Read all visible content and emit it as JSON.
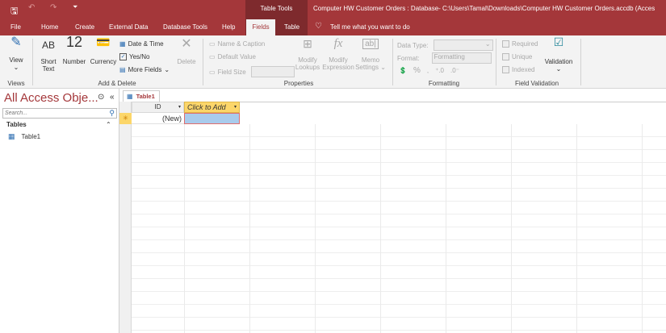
{
  "titlebar": {
    "context_group": "Table Tools",
    "title": "Computer HW Customer Orders : Database- C:\\Users\\Tamal\\Downloads\\Computer HW Customer Orders.accdb (Acces"
  },
  "tabs": [
    "File",
    "Home",
    "Create",
    "External Data",
    "Database Tools",
    "Help",
    "Fields",
    "Table"
  ],
  "tell_me": "Tell me what you want to do",
  "ribbon": {
    "views": {
      "view": "View",
      "group": "Views"
    },
    "add_delete": {
      "short_text_icon": "AB",
      "short_text": "Short Text",
      "number_icon": "12",
      "number": "Number",
      "currency": "Currency",
      "date_time": "Date & Time",
      "yes_no": "Yes/No",
      "more_fields": "More Fields",
      "delete": "Delete",
      "group": "Add & Delete"
    },
    "properties": {
      "name_caption": "Name & Caption",
      "default_value": "Default Value",
      "field_size": "Field Size",
      "modify_lookups": "Modify Lookups",
      "modify_expression": "Modify Expression",
      "memo_settings": "Memo Settings",
      "group": "Properties"
    },
    "formatting": {
      "data_type": "Data Type:",
      "format": "Format:",
      "format_value": "Formatting",
      "percent": "%",
      "comma": ",",
      "group": "Formatting"
    },
    "validation": {
      "required": "Required",
      "unique": "Unique",
      "indexed": "Indexed",
      "validation": "Validation",
      "group": "Field Validation"
    }
  },
  "nav": {
    "title": "All Access Obje...",
    "search_placeholder": "Search...",
    "section": "Tables",
    "items": [
      "Table1"
    ]
  },
  "datasheet": {
    "tab": "Table1",
    "columns": [
      "ID",
      "Click to Add"
    ],
    "new_row": "(New)",
    "new_marker": "✳"
  },
  "colors": {
    "accent": "#a4373a"
  }
}
